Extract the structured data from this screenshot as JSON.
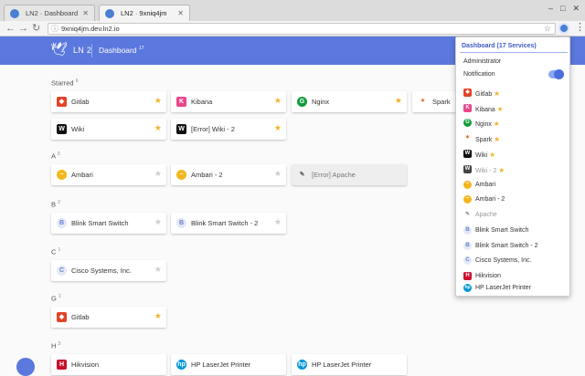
{
  "browser": {
    "tabs": [
      {
        "title": "LN2 · Dashboard",
        "active": false
      },
      {
        "title": "LN2 · 9xniq4jm",
        "active": true
      }
    ],
    "url": "9xniq4jm.dev.ln2.io"
  },
  "app": {
    "name": "LN 2",
    "section": "Dashboard",
    "count": "17"
  },
  "sections": [
    {
      "label": "Starred",
      "count": "6"
    },
    {
      "label": "A",
      "count": "3"
    },
    {
      "label": "B",
      "count": "2"
    },
    {
      "label": "C",
      "count": "1"
    },
    {
      "label": "G",
      "count": "1"
    },
    {
      "label": "H",
      "count": "3"
    }
  ],
  "cards": {
    "starred": [
      {
        "name": "Gitlab",
        "icon": "gitlab-icon",
        "color": "#e24329"
      },
      {
        "name": "Kibana",
        "icon": "kibana-icon",
        "color": "#e8478b"
      },
      {
        "name": "Nginx",
        "icon": "nginx-icon",
        "color": "#119c3d"
      },
      {
        "name": "Spark",
        "icon": "spark-icon",
        "color": "#e25a1c"
      },
      {
        "name": "Wiki",
        "icon": "wiki-icon",
        "color": "#111111"
      },
      {
        "name": "[Error] Wiki - 2",
        "icon": "wiki-icon",
        "color": "#111111"
      }
    ],
    "a": [
      {
        "name": "Ambari",
        "icon": "ambari-icon",
        "color": "#f3b71c"
      },
      {
        "name": "Ambari - 2",
        "icon": "ambari-icon",
        "color": "#f3b71c"
      },
      {
        "name": "[Error] Apache",
        "icon": "apache-icon",
        "color": "#888888"
      }
    ],
    "b": [
      {
        "name": "Blink Smart Switch",
        "icon": "blink-icon",
        "letter": "B"
      },
      {
        "name": "Blink Smart Switch - 2",
        "icon": "blink-icon",
        "letter": "B"
      }
    ],
    "c": [
      {
        "name": "Cisco Systems, Inc.",
        "icon": "cisco-icon",
        "letter": "C"
      }
    ],
    "g": [
      {
        "name": "Gitlab",
        "icon": "gitlab-icon",
        "color": "#e24329"
      }
    ],
    "h": [
      {
        "name": "Hikvision"
      },
      {
        "name": "HP LaserJet Printer"
      },
      {
        "name": "HP LaserJet Printer"
      }
    ]
  },
  "popup": {
    "header": "Dashboard (17 Services)",
    "role": "Administrator",
    "notification_label": "Notification",
    "notification_on": true,
    "items": [
      {
        "name": "Gitlab",
        "starred": true
      },
      {
        "name": "Kibana",
        "starred": true
      },
      {
        "name": "Nginx",
        "starred": true
      },
      {
        "name": "Spark",
        "starred": true
      },
      {
        "name": "Wiki",
        "starred": true
      },
      {
        "name": "Wiki - 2",
        "starred": true,
        "error": true
      },
      {
        "name": "Ambari",
        "starred": false
      },
      {
        "name": "Ambari - 2",
        "starred": false
      },
      {
        "name": "Apache",
        "starred": false,
        "error": true
      },
      {
        "name": "Blink Smart Switch",
        "starred": false
      },
      {
        "name": "Blink Smart Switch - 2",
        "starred": false
      },
      {
        "name": "Cisco Systems, Inc.",
        "starred": false
      },
      {
        "name": "Hikvision",
        "starred": false
      },
      {
        "name": "HP LaserJet Printer",
        "starred": false
      }
    ]
  },
  "icons": {
    "star": "★"
  },
  "colors": {
    "brand": "#5a78dd",
    "star": "#f0b429"
  }
}
